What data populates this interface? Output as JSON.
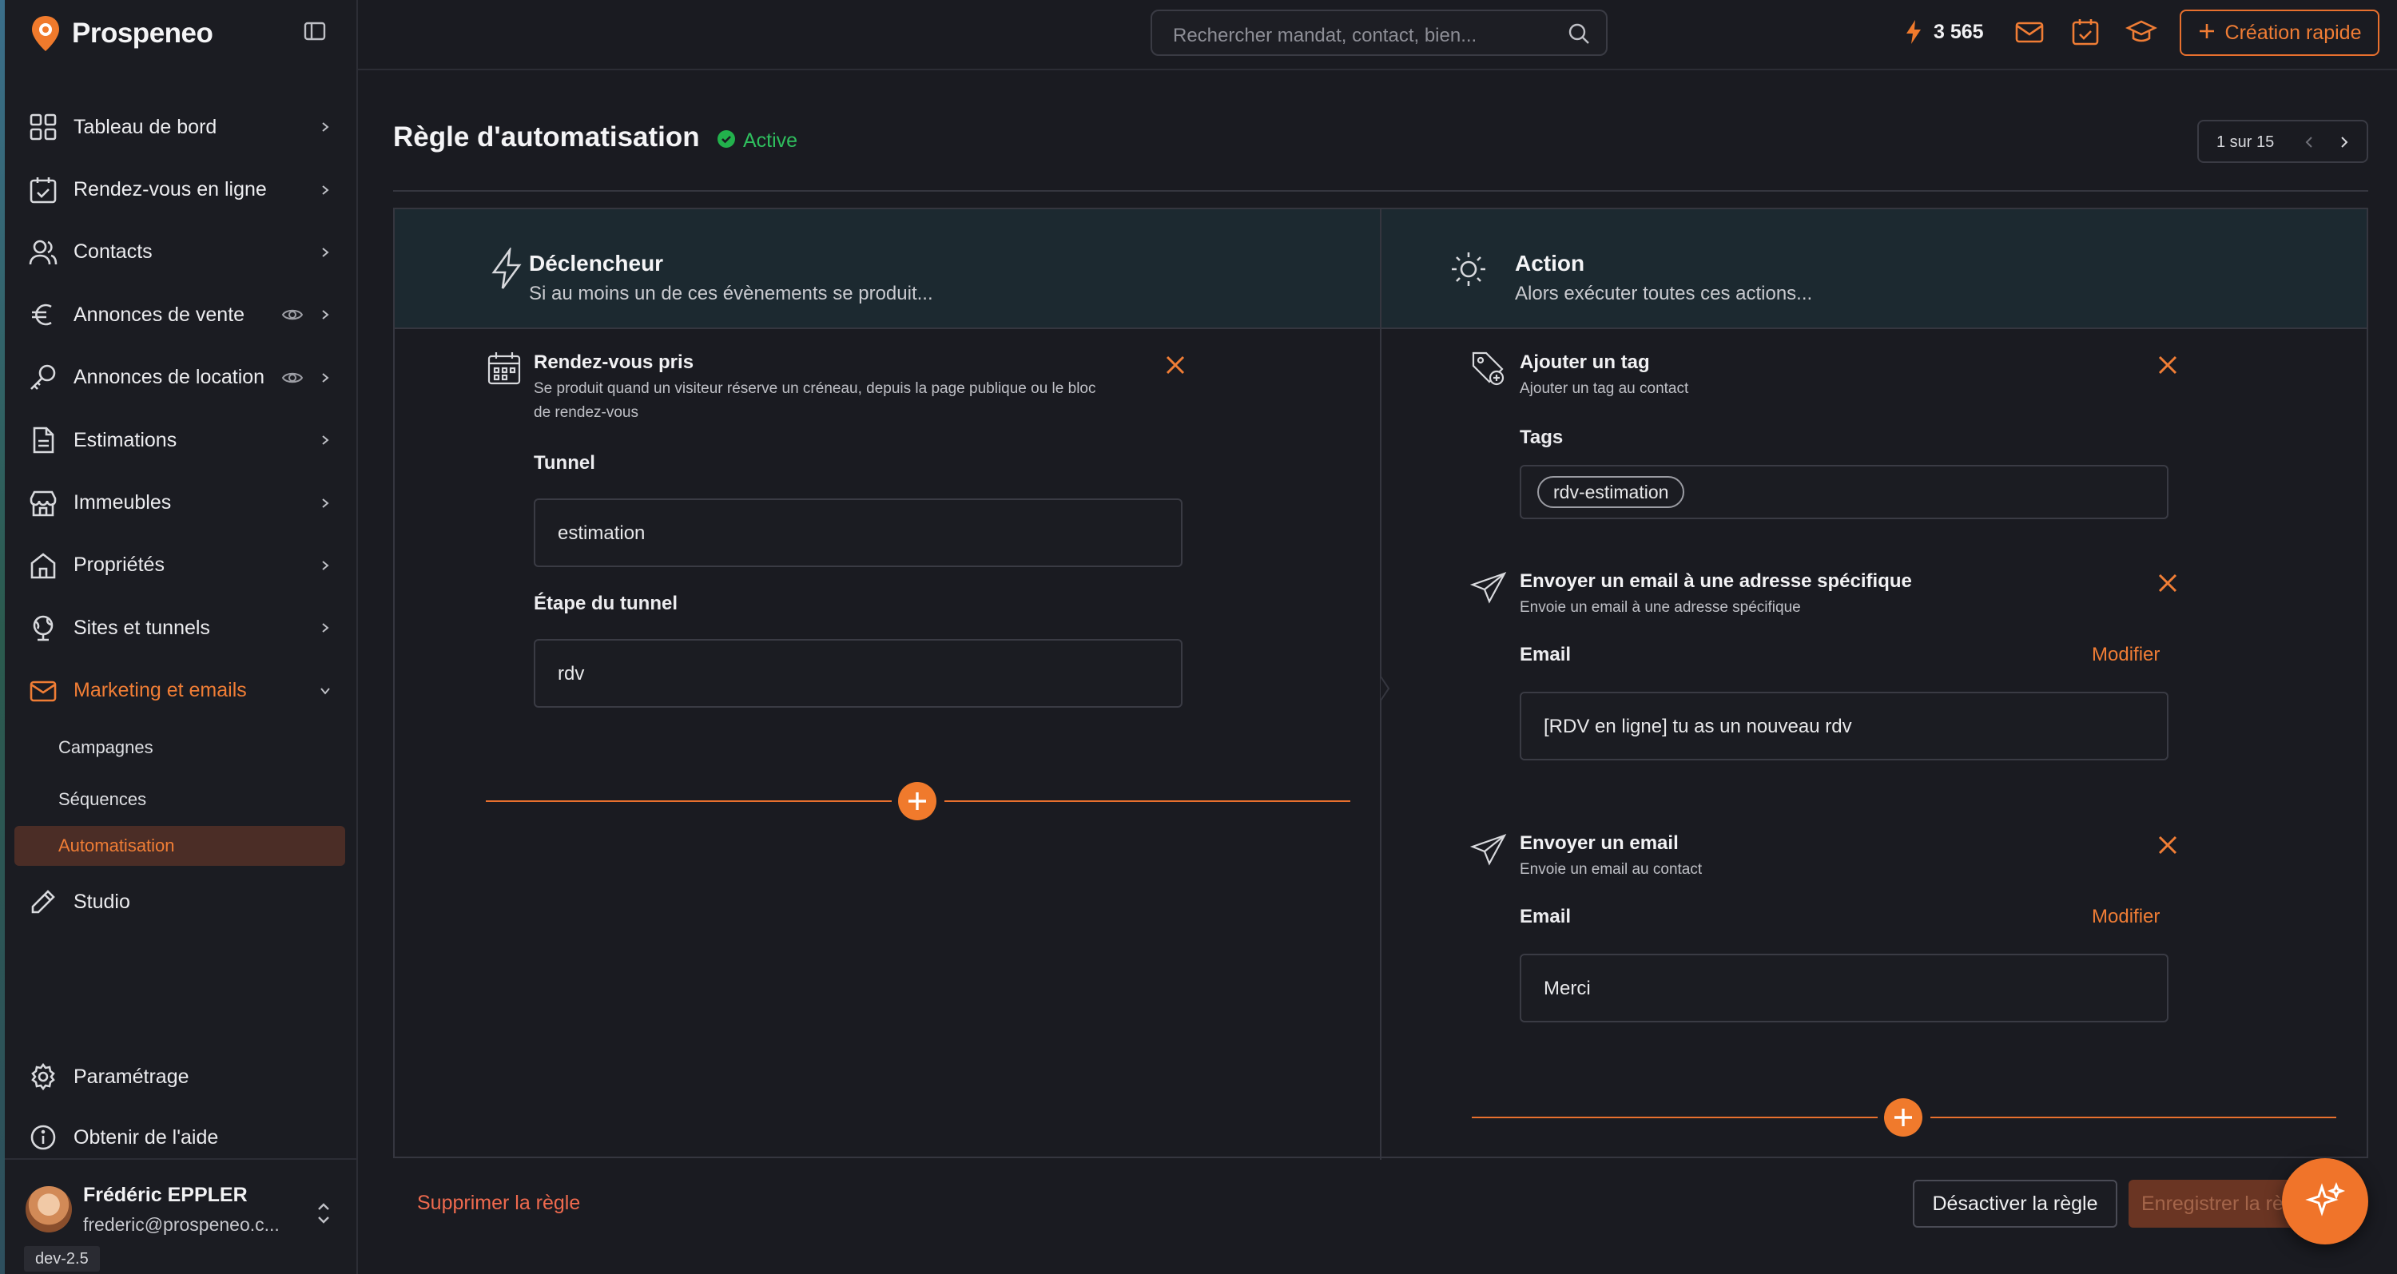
{
  "app": {
    "name": "Prospeneo",
    "credits": "3 565",
    "quick_create": "Création rapide",
    "env": "dev-2.5"
  },
  "search": {
    "placeholder": "Rechercher mandat, contact, bien..."
  },
  "sidebar": {
    "items": [
      {
        "label": "Tableau de bord",
        "icon": "dashboard-icon"
      },
      {
        "label": "Rendez-vous en ligne",
        "icon": "calendar-check-icon"
      },
      {
        "label": "Contacts",
        "icon": "users-icon"
      },
      {
        "label": "Annonces de vente",
        "icon": "euro-icon"
      },
      {
        "label": "Annonces de location",
        "icon": "key-icon"
      },
      {
        "label": "Estimations",
        "icon": "document-icon"
      },
      {
        "label": "Immeubles",
        "icon": "store-icon"
      },
      {
        "label": "Propriétés",
        "icon": "house-icon"
      },
      {
        "label": "Sites et tunnels",
        "icon": "globe-icon"
      },
      {
        "label": "Marketing et emails",
        "icon": "mail-icon"
      }
    ],
    "sub_items": [
      "Campagnes",
      "Séquences",
      "Automatisation"
    ],
    "studio": "Studio",
    "settings": "Paramétrage",
    "help": "Obtenir de l'aide"
  },
  "user": {
    "name": "Frédéric EPPLER",
    "email": "frederic@prospeneo.c..."
  },
  "page": {
    "title": "Règle d'automatisation",
    "status": "Active",
    "pager": "1 sur 15"
  },
  "trigger": {
    "title": "Déclencheur",
    "subtitle": "Si au moins un de ces évènements se produit...",
    "card": {
      "title": "Rendez-vous pris",
      "desc_line1": "Se produit quand un visiteur réserve un créneau, depuis la page publique ou le bloc",
      "desc_line2": "de rendez-vous",
      "tunnel_label": "Tunnel",
      "tunnel_value": "estimation",
      "step_label": "Étape du tunnel",
      "step_value": "rdv"
    }
  },
  "action": {
    "title": "Action",
    "subtitle": "Alors exécuter toutes ces actions...",
    "cards": [
      {
        "title": "Ajouter un tag",
        "desc": "Ajouter un tag au contact",
        "field_label": "Tags",
        "tag": "rdv-estimation"
      },
      {
        "title": "Envoyer un email à une adresse spécifique",
        "desc": "Envoie un email à une adresse spécifique",
        "field_label": "Email",
        "modify": "Modifier",
        "value": "[RDV en ligne] tu as un nouveau rdv"
      },
      {
        "title": "Envoyer un email",
        "desc": "Envoie un email au contact",
        "field_label": "Email",
        "modify": "Modifier",
        "value": "Merci"
      }
    ]
  },
  "footer": {
    "delete": "Supprimer la règle",
    "deactivate": "Désactiver la règle",
    "save": "Enregistrer la règle"
  },
  "colors": {
    "accent": "#f07d35",
    "status": "#22b14c",
    "bg": "#1a1b21",
    "header_bg": "#1c2930"
  }
}
